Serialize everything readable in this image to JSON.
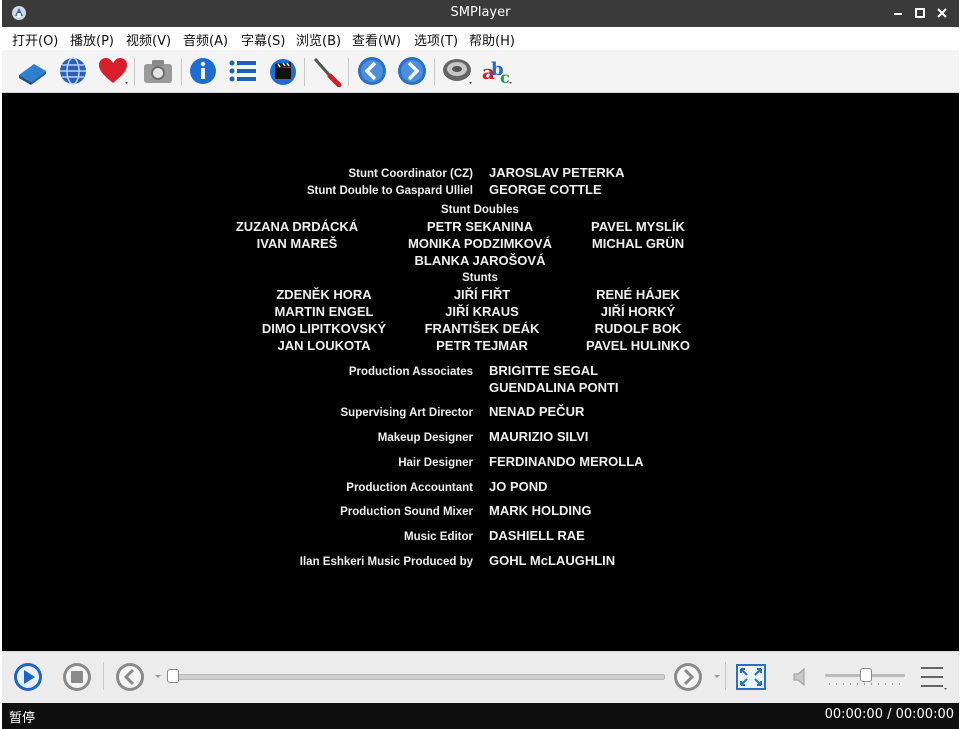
{
  "window": {
    "title": "SMPlayer"
  },
  "menu": [
    {
      "label": "打开(O)"
    },
    {
      "label": "播放(P)"
    },
    {
      "label": "视频(V)"
    },
    {
      "label": "音频(A)"
    },
    {
      "label": "字幕(S)"
    },
    {
      "label": "浏览(B)"
    },
    {
      "label": "查看(W)"
    },
    {
      "label": "选项(T)"
    },
    {
      "label": "帮助(H)"
    }
  ],
  "toolbar": [
    "open-file-icon",
    "open-url-icon",
    "favorites-icon",
    "screenshot-icon",
    "info-icon",
    "playlist-icon",
    "media-clapper-icon",
    "preferences-icon",
    "previous-icon",
    "next-icon",
    "audio-track-icon",
    "subtitles-icon"
  ],
  "credits": {
    "stunt_coordinator_role": "Stunt Coordinator (CZ)",
    "stunt_coordinator_name": "JAROSLAV PETERKA",
    "stunt_double_role": "Stunt Double to Gaspard Ulliel",
    "stunt_double_name": "GEORGE COTTLE",
    "stunt_doubles_header": "Stunt Doubles",
    "stunt_doubles_left": [
      "ZUZANA DRDÁCKÁ",
      "IVAN MAREŠ"
    ],
    "stunt_doubles_center": [
      "PETR SEKANINA",
      "MONIKA PODZIMKOVÁ",
      "BLANKA JAROŠOVÁ"
    ],
    "stunt_doubles_right": [
      "PAVEL MYSLÍK",
      "MICHAL GRÜN"
    ],
    "stunts_header": "Stunts",
    "stunts_left": [
      "ZDENĚK HORA",
      "MARTIN ENGEL",
      "DIMO LIPITKOVSKÝ",
      "JAN LOUKOTA"
    ],
    "stunts_center": [
      "JIŘÍ FIŘT",
      "JIŘÍ KRAUS",
      "FRANTIŠEK DEÁK",
      "PETR TEJMAR"
    ],
    "stunts_right": [
      "RENÉ HÁJEK",
      "JIŘÍ HORKÝ",
      "RUDOLF BOK",
      "PAVEL HULINKO"
    ],
    "roles": [
      {
        "role": "Production Associates",
        "names": [
          "BRIGITTE SEGAL",
          "GUENDALINA PONTI"
        ]
      },
      {
        "role": "Supervising Art Director",
        "names": [
          "NENAD PEČUR"
        ]
      },
      {
        "role": "Makeup Designer",
        "names": [
          "MAURIZIO SILVI"
        ]
      },
      {
        "role": "Hair Designer",
        "names": [
          "FERDINANDO MEROLLA"
        ]
      },
      {
        "role": "Production Accountant",
        "names": [
          "JO POND"
        ]
      },
      {
        "role": "Production Sound Mixer",
        "names": [
          "MARK HOLDING"
        ]
      },
      {
        "role": "Music Editor",
        "names": [
          "DASHIELL RAE"
        ]
      },
      {
        "role": "Ilan Eshkeri Music Produced by",
        "names": [
          "GOHL McLAUGHLIN"
        ]
      }
    ]
  },
  "controls": {
    "seek_fraction": 0.0,
    "volume_fraction": 0.5
  },
  "status": {
    "state": "暂停",
    "time": "00:00:00 / 00:00:00"
  }
}
